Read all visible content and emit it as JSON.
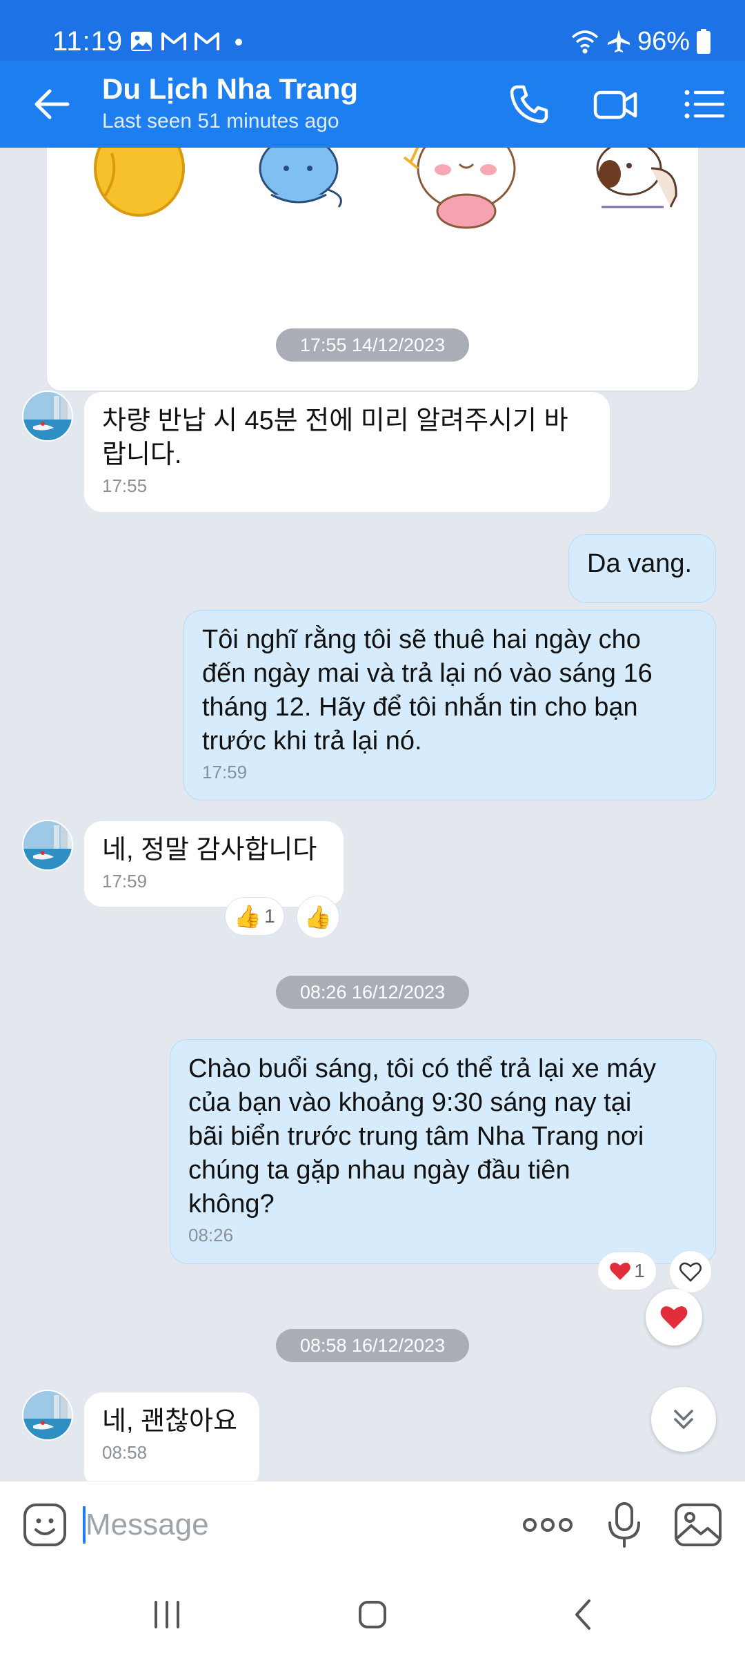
{
  "status_bar": {
    "time": "11:19",
    "battery": "96%",
    "notification_icons": [
      "gallery-icon",
      "gmail-icon",
      "gmail-icon",
      "dot-icon"
    ],
    "system_icons": [
      "wifi-icon",
      "airplane-mode-icon",
      "battery-icon"
    ]
  },
  "header": {
    "title": "Du Lịch Nha Trang",
    "subtitle": "Last seen 51 minutes ago",
    "accent_color": "#1d7ef0"
  },
  "messages": [
    {
      "type": "date",
      "label": "17:55 14/12/2023"
    },
    {
      "type": "incoming",
      "text": "차량 반납 시 45분 전에 미리 알려주시기 바\n랍니다.",
      "time": "17:55"
    },
    {
      "type": "outgoing",
      "text": "Da vang."
    },
    {
      "type": "outgoing",
      "text": "Tôi nghĩ rằng tôi sẽ thuê hai ngày cho\nđến ngày mai và trả lại nó vào sáng 16\ntháng 12. Hãy để tôi nhắn tin cho bạn\ntrước khi trả lại nó.",
      "time": "17:59"
    },
    {
      "type": "incoming",
      "text": "네, 정말 감사합니다",
      "time": "17:59",
      "reaction": {
        "icon": "thumbs-up",
        "count": "1"
      }
    },
    {
      "type": "date",
      "label": "08:26 16/12/2023"
    },
    {
      "type": "outgoing",
      "text": "Chào buổi sáng, tôi có thể trả lại xe máy\ncủa bạn vào khoảng 9:30 sáng nay tại\nbãi biển trước trung tâm Nha Trang nơi\nchúng ta gặp nhau ngày đầu tiên\nkhông?",
      "time": "08:26",
      "reaction": {
        "icon": "heart",
        "count": "1"
      }
    },
    {
      "type": "date",
      "label": "08:58 16/12/2023"
    },
    {
      "type": "incoming",
      "text": "네, 괜찮아요",
      "time": "08:58"
    }
  ],
  "composer": {
    "placeholder": "Message"
  }
}
